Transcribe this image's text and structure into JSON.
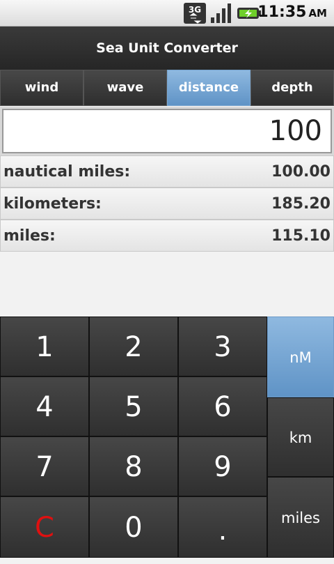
{
  "status": {
    "network": "3G",
    "time": "11:35",
    "ampm": "AM"
  },
  "app": {
    "title": "Sea Unit Converter"
  },
  "tabs": [
    {
      "label": "wind",
      "active": false
    },
    {
      "label": "wave",
      "active": false
    },
    {
      "label": "distance",
      "active": true
    },
    {
      "label": "depth",
      "active": false
    }
  ],
  "input": {
    "value": "100"
  },
  "results": [
    {
      "label": "nautical miles:",
      "value": "100.00"
    },
    {
      "label": "kilometers:",
      "value": "185.20"
    },
    {
      "label": "miles:",
      "value": "115.10"
    }
  ],
  "keypad": {
    "digits": [
      "1",
      "2",
      "3",
      "4",
      "5",
      "6",
      "7",
      "8",
      "9",
      "C",
      "0",
      "."
    ],
    "units": [
      {
        "label": "nM",
        "active": true
      },
      {
        "label": "km",
        "active": false
      },
      {
        "label": "miles",
        "active": false
      }
    ]
  },
  "colors": {
    "accent": "#6fa3d4",
    "clear": "#e01010",
    "title_bg": "#2e2e2e"
  }
}
